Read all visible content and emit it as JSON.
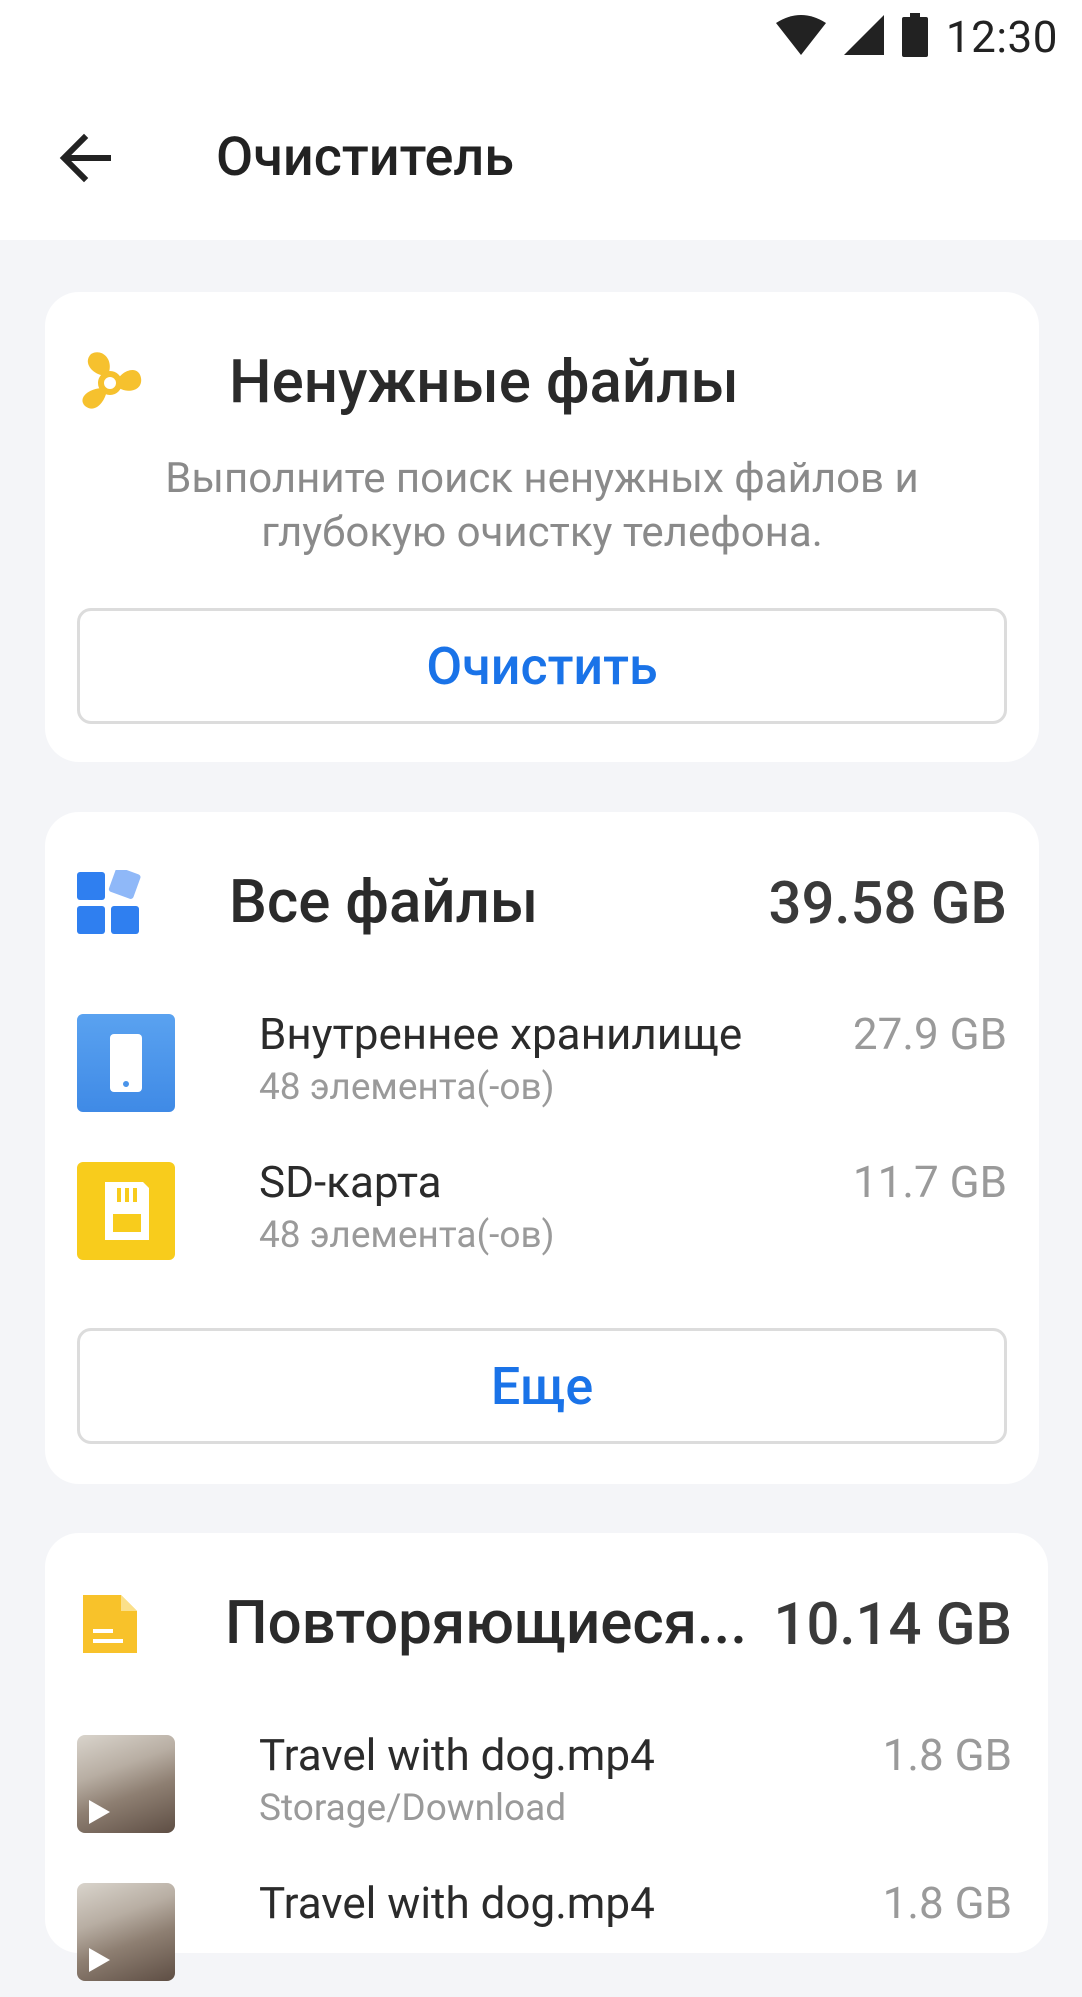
{
  "status": {
    "time": "12:30"
  },
  "appbar": {
    "title": "Очиститель"
  },
  "junk": {
    "title": "Ненужные файлы",
    "description": "Выполните поиск ненужных файлов и глубокую очистку телефона.",
    "button": "Очистить"
  },
  "files": {
    "title": "Все файлы",
    "total": "39.58 GB",
    "items": [
      {
        "name": "Внутреннее хранилище",
        "sub": "48 элемента(-ов)",
        "size": "27.9 GB",
        "icon": "phone-icon"
      },
      {
        "name": "SD-карта",
        "sub": "48 элемента(-ов)",
        "size": "11.7 GB",
        "icon": "sd-card-icon"
      }
    ],
    "button": "Еще"
  },
  "duplicates": {
    "title": "Повторяющиеся...",
    "total": "10.14 GB",
    "items": [
      {
        "name": "Travel with dog.mp4",
        "sub": "Storage/Download",
        "size": "1.8 GB"
      },
      {
        "name": "Travel with dog.mp4",
        "sub": "",
        "size": "1.8 GB"
      }
    ]
  },
  "colors": {
    "accent": "#1a73e8",
    "fan": "#f6c12e",
    "tiles": "#2f7ff0",
    "doc": "#f8c22a"
  }
}
